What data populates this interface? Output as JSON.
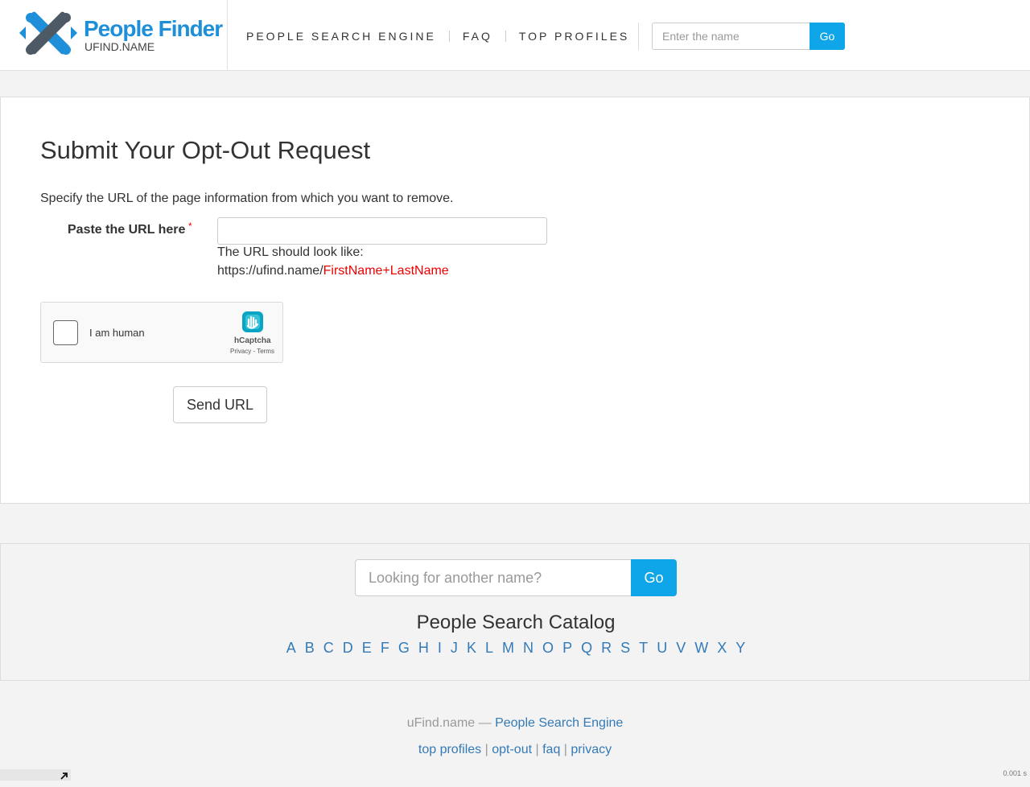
{
  "header": {
    "logo_title": "People Finder",
    "logo_sub": "UFIND.NAME",
    "nav": [
      {
        "label": "PEOPLE SEARCH ENGINE"
      },
      {
        "label": "FAQ"
      },
      {
        "label": "TOP PROFILES"
      }
    ],
    "search_placeholder": "Enter the name",
    "search_button": "Go"
  },
  "main": {
    "title": "Submit Your Opt-Out Request",
    "description": "Specify the URL of the page information from which you want to remove.",
    "url_label": "Paste the URL here",
    "required_mark": "*",
    "url_value": "",
    "hint_line1": "The URL should look like:",
    "hint_prefix": "https://ufind.name/",
    "hint_example": "FirstName+LastName",
    "captcha": {
      "label": "I am human",
      "brand": "hCaptcha",
      "links": "Privacy - Terms"
    },
    "send_button": "Send URL"
  },
  "catalog": {
    "search_placeholder": "Looking for another name?",
    "search_button": "Go",
    "title": "People Search Catalog",
    "letters": [
      "A",
      "B",
      "C",
      "D",
      "E",
      "F",
      "G",
      "H",
      "I",
      "J",
      "K",
      "L",
      "M",
      "N",
      "O",
      "P",
      "Q",
      "R",
      "S",
      "T",
      "U",
      "V",
      "W",
      "X",
      "Y"
    ]
  },
  "footer": {
    "brand": "uFind.name —",
    "brand_link": "People Search Engine",
    "links": [
      {
        "label": "top profiles"
      },
      {
        "label": "opt-out"
      },
      {
        "label": "faq"
      },
      {
        "label": "privacy"
      }
    ],
    "separator": "|",
    "timing": "0.001 s"
  },
  "colors": {
    "accent": "#0ea6e8",
    "link": "#337ab7",
    "required": "#ee0000",
    "logo_blue": "#1e8fd8"
  }
}
